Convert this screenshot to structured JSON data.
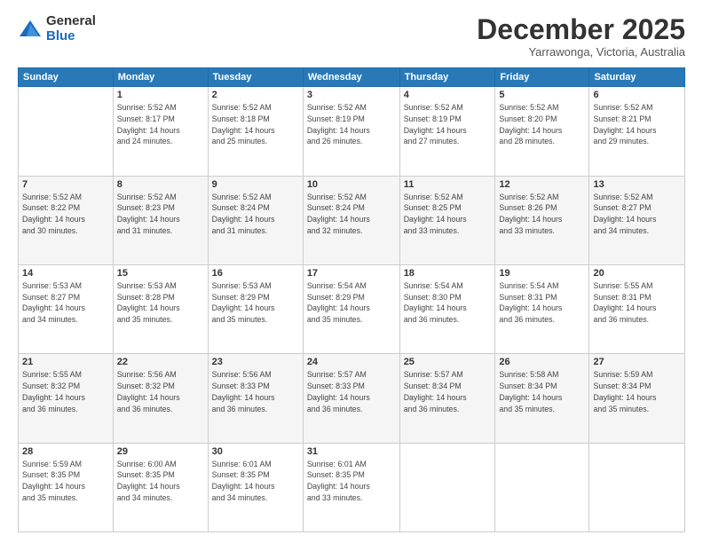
{
  "logo": {
    "general": "General",
    "blue": "Blue"
  },
  "header": {
    "month": "December 2025",
    "location": "Yarrawonga, Victoria, Australia"
  },
  "days_of_week": [
    "Sunday",
    "Monday",
    "Tuesday",
    "Wednesday",
    "Thursday",
    "Friday",
    "Saturday"
  ],
  "weeks": [
    [
      {
        "day": "",
        "info": ""
      },
      {
        "day": "1",
        "info": "Sunrise: 5:52 AM\nSunset: 8:17 PM\nDaylight: 14 hours\nand 24 minutes."
      },
      {
        "day": "2",
        "info": "Sunrise: 5:52 AM\nSunset: 8:18 PM\nDaylight: 14 hours\nand 25 minutes."
      },
      {
        "day": "3",
        "info": "Sunrise: 5:52 AM\nSunset: 8:19 PM\nDaylight: 14 hours\nand 26 minutes."
      },
      {
        "day": "4",
        "info": "Sunrise: 5:52 AM\nSunset: 8:19 PM\nDaylight: 14 hours\nand 27 minutes."
      },
      {
        "day": "5",
        "info": "Sunrise: 5:52 AM\nSunset: 8:20 PM\nDaylight: 14 hours\nand 28 minutes."
      },
      {
        "day": "6",
        "info": "Sunrise: 5:52 AM\nSunset: 8:21 PM\nDaylight: 14 hours\nand 29 minutes."
      }
    ],
    [
      {
        "day": "7",
        "info": "Sunrise: 5:52 AM\nSunset: 8:22 PM\nDaylight: 14 hours\nand 30 minutes."
      },
      {
        "day": "8",
        "info": "Sunrise: 5:52 AM\nSunset: 8:23 PM\nDaylight: 14 hours\nand 31 minutes."
      },
      {
        "day": "9",
        "info": "Sunrise: 5:52 AM\nSunset: 8:24 PM\nDaylight: 14 hours\nand 31 minutes."
      },
      {
        "day": "10",
        "info": "Sunrise: 5:52 AM\nSunset: 8:24 PM\nDaylight: 14 hours\nand 32 minutes."
      },
      {
        "day": "11",
        "info": "Sunrise: 5:52 AM\nSunset: 8:25 PM\nDaylight: 14 hours\nand 33 minutes."
      },
      {
        "day": "12",
        "info": "Sunrise: 5:52 AM\nSunset: 8:26 PM\nDaylight: 14 hours\nand 33 minutes."
      },
      {
        "day": "13",
        "info": "Sunrise: 5:52 AM\nSunset: 8:27 PM\nDaylight: 14 hours\nand 34 minutes."
      }
    ],
    [
      {
        "day": "14",
        "info": "Sunrise: 5:53 AM\nSunset: 8:27 PM\nDaylight: 14 hours\nand 34 minutes."
      },
      {
        "day": "15",
        "info": "Sunrise: 5:53 AM\nSunset: 8:28 PM\nDaylight: 14 hours\nand 35 minutes."
      },
      {
        "day": "16",
        "info": "Sunrise: 5:53 AM\nSunset: 8:29 PM\nDaylight: 14 hours\nand 35 minutes."
      },
      {
        "day": "17",
        "info": "Sunrise: 5:54 AM\nSunset: 8:29 PM\nDaylight: 14 hours\nand 35 minutes."
      },
      {
        "day": "18",
        "info": "Sunrise: 5:54 AM\nSunset: 8:30 PM\nDaylight: 14 hours\nand 36 minutes."
      },
      {
        "day": "19",
        "info": "Sunrise: 5:54 AM\nSunset: 8:31 PM\nDaylight: 14 hours\nand 36 minutes."
      },
      {
        "day": "20",
        "info": "Sunrise: 5:55 AM\nSunset: 8:31 PM\nDaylight: 14 hours\nand 36 minutes."
      }
    ],
    [
      {
        "day": "21",
        "info": "Sunrise: 5:55 AM\nSunset: 8:32 PM\nDaylight: 14 hours\nand 36 minutes."
      },
      {
        "day": "22",
        "info": "Sunrise: 5:56 AM\nSunset: 8:32 PM\nDaylight: 14 hours\nand 36 minutes."
      },
      {
        "day": "23",
        "info": "Sunrise: 5:56 AM\nSunset: 8:33 PM\nDaylight: 14 hours\nand 36 minutes."
      },
      {
        "day": "24",
        "info": "Sunrise: 5:57 AM\nSunset: 8:33 PM\nDaylight: 14 hours\nand 36 minutes."
      },
      {
        "day": "25",
        "info": "Sunrise: 5:57 AM\nSunset: 8:34 PM\nDaylight: 14 hours\nand 36 minutes."
      },
      {
        "day": "26",
        "info": "Sunrise: 5:58 AM\nSunset: 8:34 PM\nDaylight: 14 hours\nand 35 minutes."
      },
      {
        "day": "27",
        "info": "Sunrise: 5:59 AM\nSunset: 8:34 PM\nDaylight: 14 hours\nand 35 minutes."
      }
    ],
    [
      {
        "day": "28",
        "info": "Sunrise: 5:59 AM\nSunset: 8:35 PM\nDaylight: 14 hours\nand 35 minutes."
      },
      {
        "day": "29",
        "info": "Sunrise: 6:00 AM\nSunset: 8:35 PM\nDaylight: 14 hours\nand 34 minutes."
      },
      {
        "day": "30",
        "info": "Sunrise: 6:01 AM\nSunset: 8:35 PM\nDaylight: 14 hours\nand 34 minutes."
      },
      {
        "day": "31",
        "info": "Sunrise: 6:01 AM\nSunset: 8:35 PM\nDaylight: 14 hours\nand 33 minutes."
      },
      {
        "day": "",
        "info": ""
      },
      {
        "day": "",
        "info": ""
      },
      {
        "day": "",
        "info": ""
      }
    ]
  ]
}
